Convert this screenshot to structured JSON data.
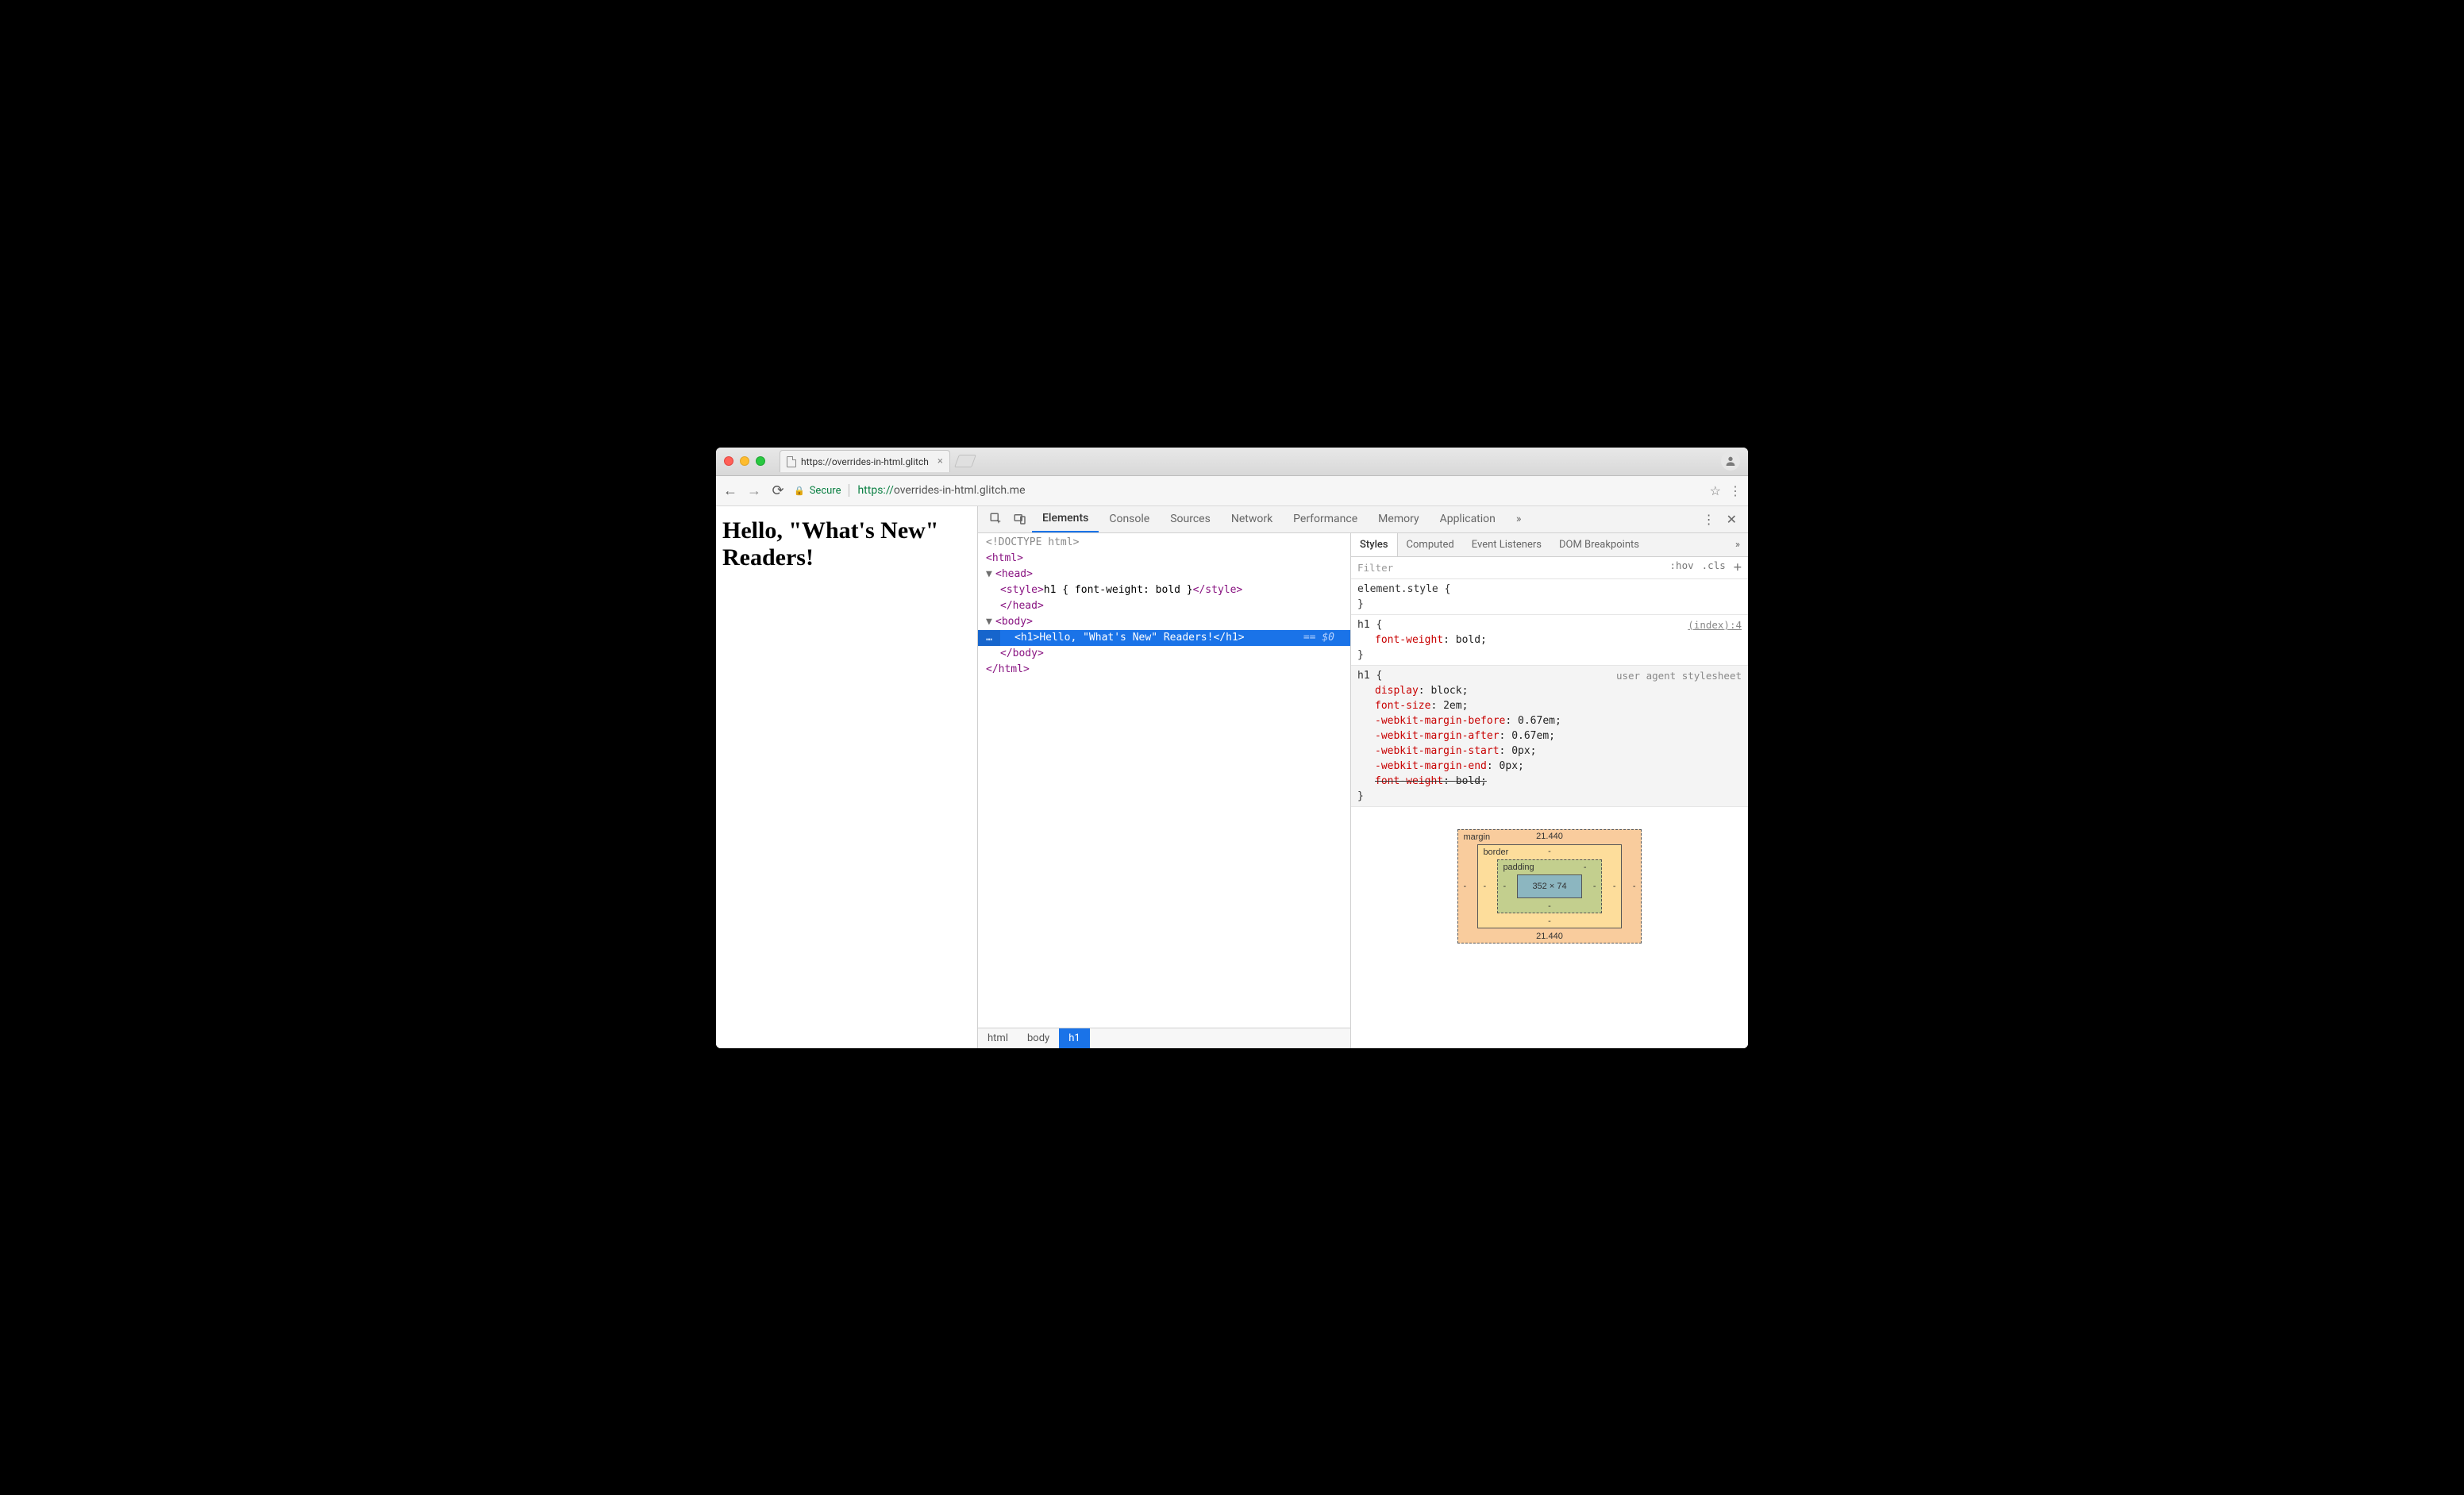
{
  "window": {
    "tab_title": "https://overrides-in-html.glitch"
  },
  "address": {
    "secure_label": "Secure",
    "protocol": "https://",
    "host_path": "overrides-in-html.glitch.me"
  },
  "page": {
    "h1": "Hello, \"What's New\" Readers!"
  },
  "devtools": {
    "tabs": [
      "Elements",
      "Console",
      "Sources",
      "Network",
      "Performance",
      "Memory",
      "Application"
    ],
    "overflow": "»",
    "dom": {
      "doctype": "<!DOCTYPE html>",
      "html_open": "<html>",
      "head_open": "<head>",
      "style_line_open": "<style>",
      "style_text": "h1 { font-weight: bold }",
      "style_line_close": "</style>",
      "head_close": "</head>",
      "body_open": "<body>",
      "sel_gutter": "…",
      "h1_open": "<h1>",
      "h1_text": "Hello, \"What's New\" Readers!",
      "h1_close": "</h1>",
      "sel_annot": "== $0",
      "body_close": "</body>",
      "html_close": "</html>"
    },
    "crumbs": [
      "html",
      "body",
      "h1"
    ]
  },
  "styles": {
    "tabs": [
      "Styles",
      "Computed",
      "Event Listeners",
      "DOM Breakpoints"
    ],
    "overflow": "»",
    "filter_placeholder": "Filter",
    "hov": ":hov",
    "cls": ".cls",
    "rules": {
      "elstyle_sel": "element.style {",
      "close": "}",
      "h1_sel": "h1 {",
      "src_index": "(index):4",
      "p_fw": "font-weight",
      "v_bold": "bold;",
      "ua_src": "user agent stylesheet",
      "p_display": "display",
      "v_block": "block;",
      "p_fontsize": "font-size",
      "v_2em": "2em;",
      "p_mb": "-webkit-margin-before",
      "v_067a": "0.67em;",
      "p_ma": "-webkit-margin-after",
      "v_067b": "0.67em;",
      "p_ms": "-webkit-margin-start",
      "v_0a": "0px;",
      "p_me": "-webkit-margin-end",
      "v_0b": "0px;",
      "p_fw2": "font-weight",
      "v_bold2": "bold;"
    }
  },
  "box": {
    "margin_lbl": "margin",
    "border_lbl": "border",
    "padding_lbl": "padding",
    "content": "352 × 74",
    "m_top": "21.440",
    "m_bottom": "21.440",
    "m_left": "-",
    "m_right": "-",
    "b": "-",
    "p": "-"
  }
}
